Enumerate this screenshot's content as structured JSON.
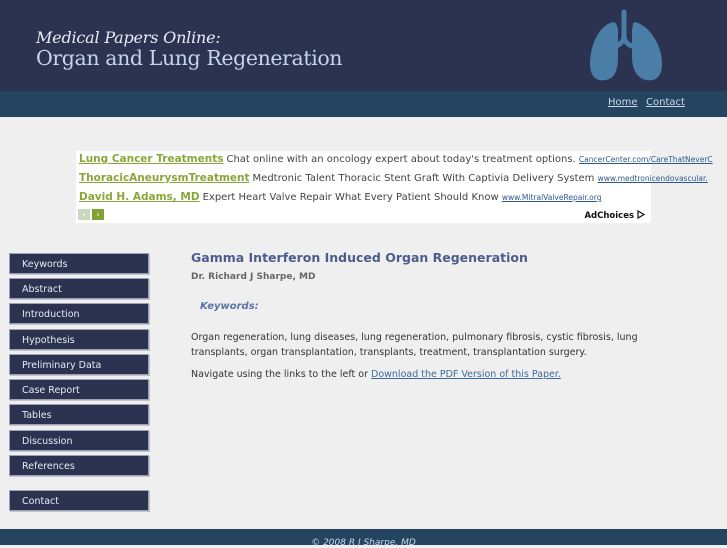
{
  "header": {
    "site_title": "Medical Papers Online:",
    "site_subtitle": "Organ and Lung Regeneration"
  },
  "top_nav": {
    "home": "Home",
    "contact": "Contact"
  },
  "ads": {
    "items": [
      {
        "title": "Lung Cancer Treatments",
        "desc": "Chat online with an oncology expert about today's treatment options.",
        "url": "CancerCenter.com/CareThatNeverC"
      },
      {
        "title": "ThoracicAneurysmTreatment",
        "desc": "Medtronic Talent Thoracic Stent Graft With Captivia Delivery System",
        "url": "www.medtronicendovascular."
      },
      {
        "title": "David H. Adams, MD",
        "desc": "Expert Heart Valve Repair What Every Patient Should Know",
        "url": "www.MitralValveRepair.org"
      }
    ],
    "prev_arrow": "‹",
    "next_arrow": "›",
    "adchoices_label": "AdChoices"
  },
  "sidebar": {
    "items": [
      {
        "label": "Keywords"
      },
      {
        "label": "Abstract"
      },
      {
        "label": "Introduction"
      },
      {
        "label": "Hypothesis"
      },
      {
        "label": "Preliminary Data"
      },
      {
        "label": "Case Report"
      },
      {
        "label": "Tables"
      },
      {
        "label": "Discussion"
      },
      {
        "label": "References"
      }
    ],
    "contact": "Contact"
  },
  "main": {
    "title": "Gamma Interferon Induced Organ Regeneration",
    "author": "Dr. Richard J Sharpe, MD",
    "keywords_heading": "Keywords:",
    "keywords_text": "Organ regeneration, lung diseases, lung regeneration, pulmonary fibrosis, cystic fibrosis, lung transplants, organ transplantation, transplants, treatment, transplantation surgery.",
    "nav_note": "Navigate using the links to the left or ",
    "pdf_link": "Download the PDF Version of this Paper."
  },
  "footer": {
    "copyright": "© 2008 R J Sharpe, MD"
  },
  "colors": {
    "header_bg": "#2b3350",
    "nav_bg": "#24445f",
    "ad_title": "#8aa63a",
    "link": "#3d6a9e",
    "lungs": "#4a7ea6"
  }
}
